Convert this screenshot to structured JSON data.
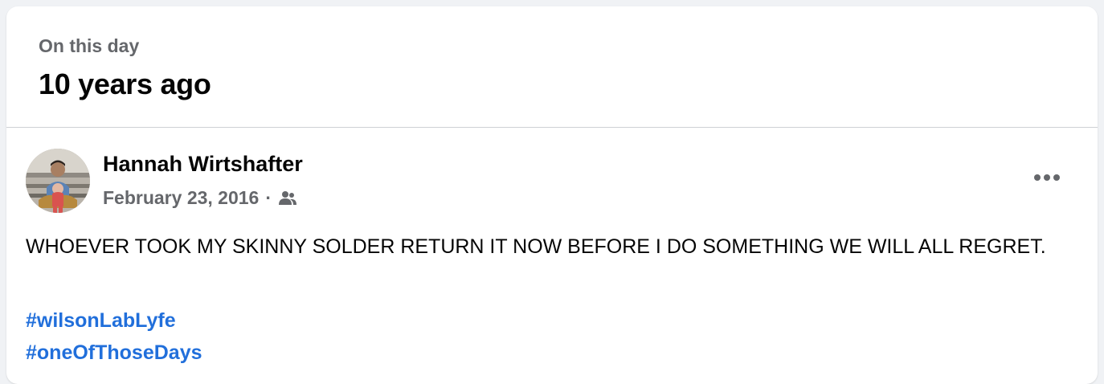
{
  "memory": {
    "subtitle": "On this day",
    "title": "10 years ago"
  },
  "post": {
    "author": "Hannah Wirtshafter",
    "date": "February 23, 2016",
    "separator": "·",
    "audience_icon": "friends-icon",
    "more_icon": "more-options-icon",
    "text": "WHOEVER TOOK MY SKINNY SOLDER RETURN IT NOW BEFORE I DO SOMETHING WE WILL ALL REGRET.",
    "hashtags": [
      "#wilsonLabLyfe",
      "#oneOfThoseDays"
    ]
  },
  "colors": {
    "link": "#216fdb",
    "secondary_text": "#65676b",
    "primary_text": "#050505"
  }
}
